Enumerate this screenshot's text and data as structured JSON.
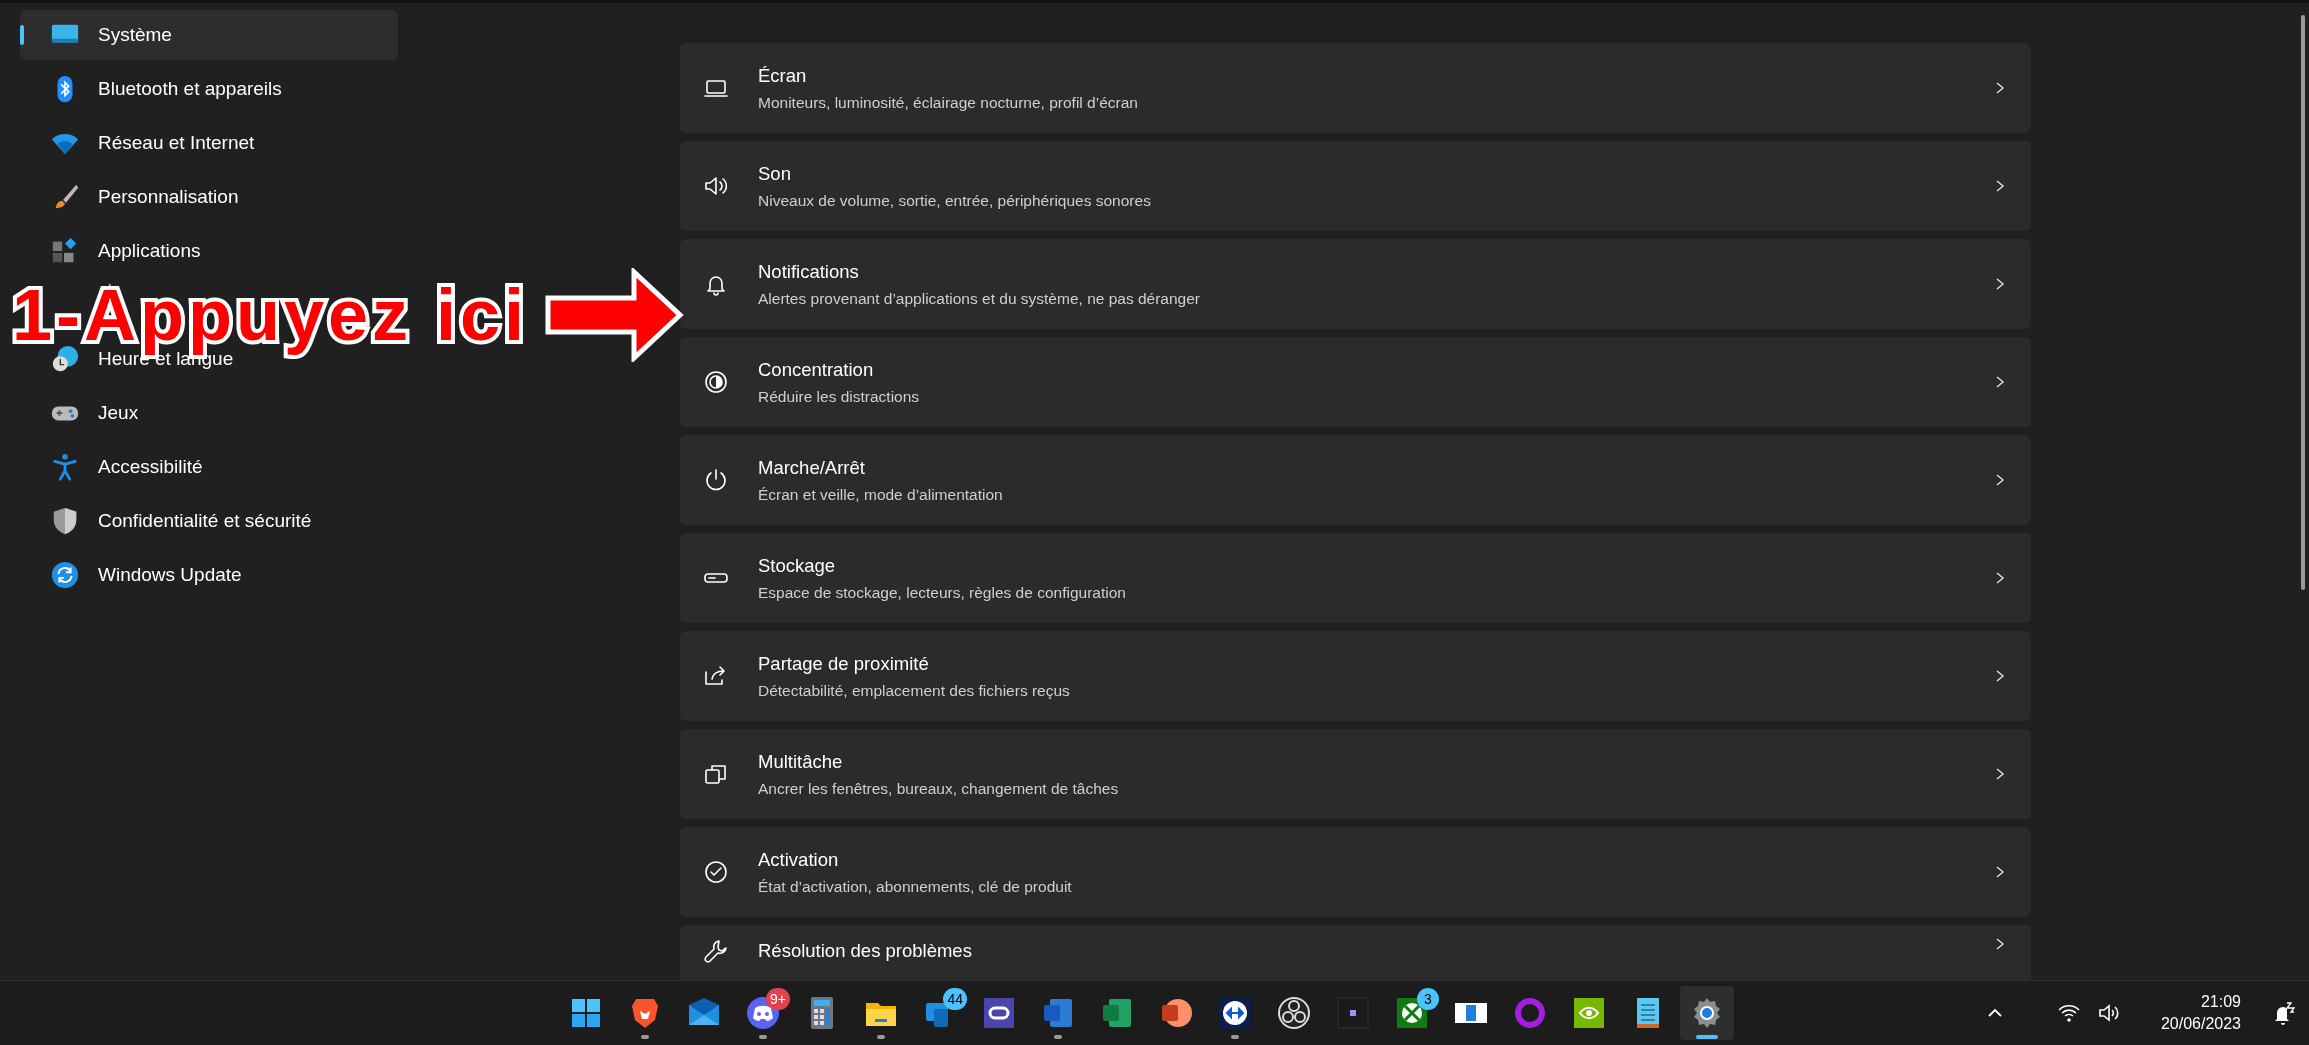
{
  "sidebar": {
    "items": [
      {
        "kind": "display",
        "label": "Système",
        "selected": true
      },
      {
        "kind": "bluetooth",
        "label": "Bluetooth et appareils",
        "selected": false
      },
      {
        "kind": "network",
        "label": "Réseau et Internet",
        "selected": false
      },
      {
        "kind": "brush",
        "label": "Personnalisation",
        "selected": false
      },
      {
        "kind": "apps",
        "label": "Applications",
        "selected": false
      },
      {
        "kind": "annotation",
        "text": "1-Appuyez ici"
      },
      {
        "kind": "clock",
        "label": "Heure et langue",
        "selected": false
      },
      {
        "kind": "gamepad",
        "label": "Jeux",
        "selected": false
      },
      {
        "kind": "accessibility",
        "label": "Accessibilité",
        "selected": false
      },
      {
        "kind": "shield",
        "label": "Confidentialité et sécurité",
        "selected": false
      },
      {
        "kind": "update",
        "label": "Windows Update",
        "selected": false
      }
    ]
  },
  "settings": [
    {
      "kind": "monitor",
      "title": "Écran",
      "subtitle": "Moniteurs, luminosité, éclairage nocturne, profil d’écran"
    },
    {
      "kind": "speaker",
      "title": "Son",
      "subtitle": "Niveaux de volume, sortie, entrée, périphériques sonores"
    },
    {
      "kind": "bell",
      "title": "Notifications",
      "subtitle": "Alertes provenant d’applications et du système, ne pas déranger"
    },
    {
      "kind": "focus",
      "title": "Concentration",
      "subtitle": "Réduire les distractions"
    },
    {
      "kind": "power",
      "title": "Marche/Arrêt",
      "subtitle": "Écran et veille, mode d’alimentation"
    },
    {
      "kind": "storage",
      "title": "Stockage",
      "subtitle": "Espace de stockage, lecteurs, règles de configuration"
    },
    {
      "kind": "share",
      "title": "Partage de proximité",
      "subtitle": "Détectabilité, emplacement des fichiers reçus"
    },
    {
      "kind": "multitask",
      "title": "Multitâche",
      "subtitle": "Ancrer les fenêtres, bureaux, changement de tâches"
    },
    {
      "kind": "check",
      "title": "Activation",
      "subtitle": "État d’activation, abonnements, clé de produit"
    },
    {
      "kind": "wrench",
      "title": "Résolution des problèmes"
    }
  ],
  "taskbar": {
    "apps": [
      {
        "kind": "start",
        "running": false,
        "active": false
      },
      {
        "kind": "brave",
        "running": true,
        "active": false
      },
      {
        "kind": "mail",
        "running": false,
        "active": false
      },
      {
        "kind": "discord",
        "badge": "9+",
        "running": true,
        "active": false
      },
      {
        "kind": "calculator",
        "running": false,
        "active": false
      },
      {
        "kind": "folder",
        "running": true,
        "active": false
      },
      {
        "kind": "phone",
        "badge": "44",
        "running": false,
        "active": false
      },
      {
        "kind": "headset",
        "running": false,
        "active": false
      },
      {
        "kind": "word",
        "running": true,
        "active": false
      },
      {
        "kind": "excel",
        "running": false,
        "active": false
      },
      {
        "kind": "powerpoint",
        "running": false,
        "active": false
      },
      {
        "kind": "teamviewer",
        "running": true,
        "active": false
      },
      {
        "kind": "obs",
        "running": false,
        "active": false
      },
      {
        "kind": "dot",
        "running": false,
        "active": false
      },
      {
        "kind": "xbox",
        "badge": "3",
        "running": false,
        "active": false
      },
      {
        "kind": "whiteboard",
        "running": false,
        "active": false
      },
      {
        "kind": "ring",
        "running": false,
        "active": false
      },
      {
        "kind": "nvidia",
        "running": false,
        "active": false
      },
      {
        "kind": "notepad",
        "running": false,
        "active": false
      },
      {
        "kind": "settings",
        "running": true,
        "active": true
      }
    ],
    "time": "21:09",
    "date": "20/06/2023"
  }
}
